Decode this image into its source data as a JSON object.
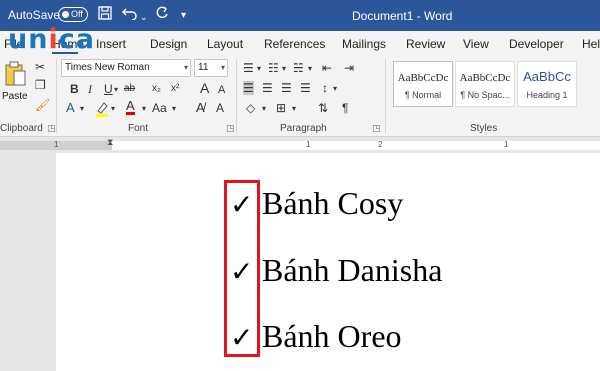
{
  "titlebar": {
    "autosave_label": "AutoSave",
    "autosave_state": "Off",
    "doc_title": "Document1  -  Word",
    "icons": [
      "save-icon",
      "undo-icon",
      "redo-icon",
      "customize-icon"
    ]
  },
  "logo": {
    "part1": "un",
    "part2": "i",
    "part3": "ca"
  },
  "tabs": {
    "file": "File",
    "home": "Home",
    "insert": "Insert",
    "design": "Design",
    "layout": "Layout",
    "references": "References",
    "mailings": "Mailings",
    "review": "Review",
    "view": "View",
    "developer": "Developer",
    "help": "Help"
  },
  "clipboard": {
    "paste_label": "Paste",
    "group_label": "Clipboard"
  },
  "font": {
    "font_name": "Times New Roman",
    "font_size": "11",
    "group_label": "Font",
    "bold": "B",
    "italic": "I",
    "underline": "U",
    "strike": "ab",
    "subscript": "x₂",
    "superscript": "x²",
    "grow": "A",
    "shrink": "A",
    "case": "Aa"
  },
  "paragraph": {
    "group_label": "Paragraph"
  },
  "styles": {
    "group_label": "Styles",
    "items": [
      {
        "sample": "AaBbCcDc",
        "name": "¶ Normal"
      },
      {
        "sample": "AaBbCcDc",
        "name": "¶ No Spac..."
      },
      {
        "sample": "AaBbCc",
        "name": "Heading 1"
      }
    ]
  },
  "ruler": {
    "numbers": [
      "1",
      "1",
      "2",
      "1"
    ]
  },
  "document": {
    "check_glyph": "✓",
    "items": [
      "Bánh Cosy",
      "Bánh Danisha",
      "Bánh Oreo"
    ]
  },
  "colors": {
    "title_bar": "#2b579a",
    "highlight_box": "#e0151f",
    "logo_blue": "#1c75bc",
    "logo_red": "#ef4136"
  }
}
